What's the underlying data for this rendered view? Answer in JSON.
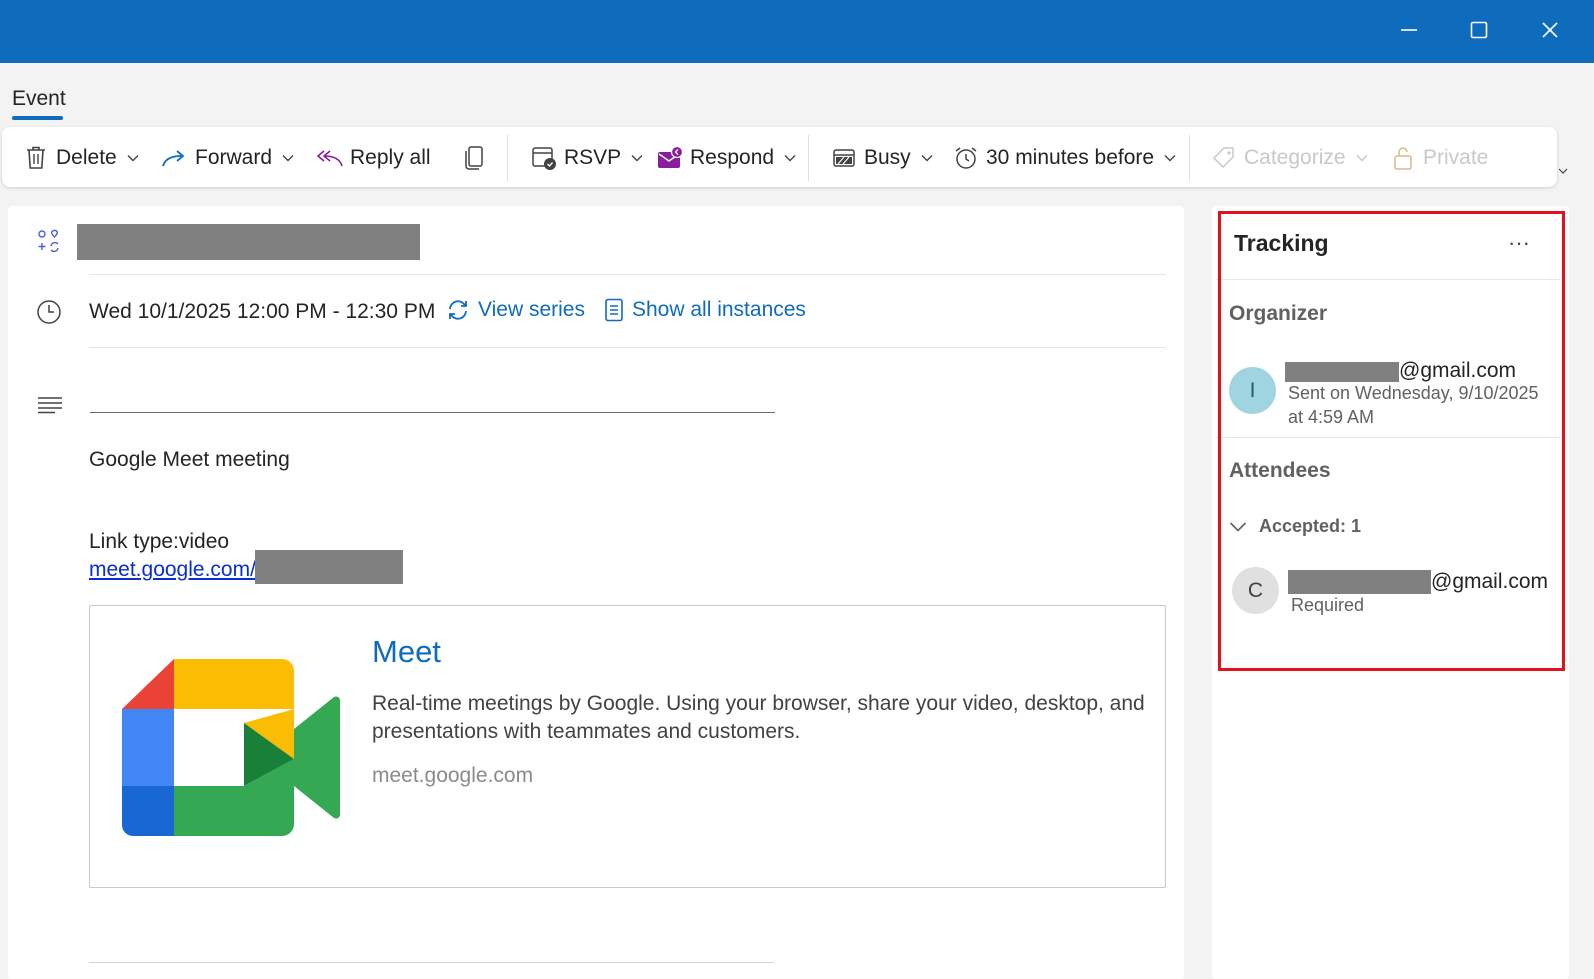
{
  "titlebar": {
    "minimize_icon": "minimize-icon",
    "maximize_icon": "maximize-icon",
    "close_icon": "close-icon"
  },
  "ribbon": {
    "tab_label": "Event"
  },
  "toolbar": {
    "delete_label": "Delete",
    "forward_label": "Forward",
    "reply_all_label": "Reply all",
    "rsvp_label": "RSVP",
    "respond_label": "Respond",
    "busy_label": "Busy",
    "reminder_label": "30 minutes before",
    "categorize_label": "Categorize",
    "private_label": "Private"
  },
  "event": {
    "when": "Wed 10/1/2025 12:00 PM - 12:30 PM",
    "view_series_label": "View series",
    "show_all_instances_label": "Show all instances",
    "body_line1": "Google Meet meeting",
    "body_line2": "Link type:video",
    "meet_link_text": "meet.google.com/"
  },
  "preview": {
    "title": "Meet",
    "description": "Real-time meetings by Google. Using your browser, share your video, desktop, and presentations with teammates and customers.",
    "domain": "meet.google.com"
  },
  "tracking": {
    "title": "Tracking",
    "more_label": "···",
    "organizer_heading": "Organizer",
    "organizer": {
      "initial": "I",
      "email_suffix": "@gmail.com",
      "sent_line1": "Sent on Wednesday, 9/10/2025",
      "sent_line2": "at 4:59 AM"
    },
    "attendees_heading": "Attendees",
    "accepted_label": "Accepted: 1",
    "attendee": {
      "initial": "C",
      "email_suffix": "@gmail.com",
      "role": "Required"
    }
  },
  "colors": {
    "titlebar": "#0f6cbd",
    "accent": "#0f6cbd",
    "highlight": "#e3121c",
    "organizer_avatar": "#9fd4e0",
    "attendee_avatar": "#e0e0e0",
    "respond_icon": "#8a1c9e"
  }
}
